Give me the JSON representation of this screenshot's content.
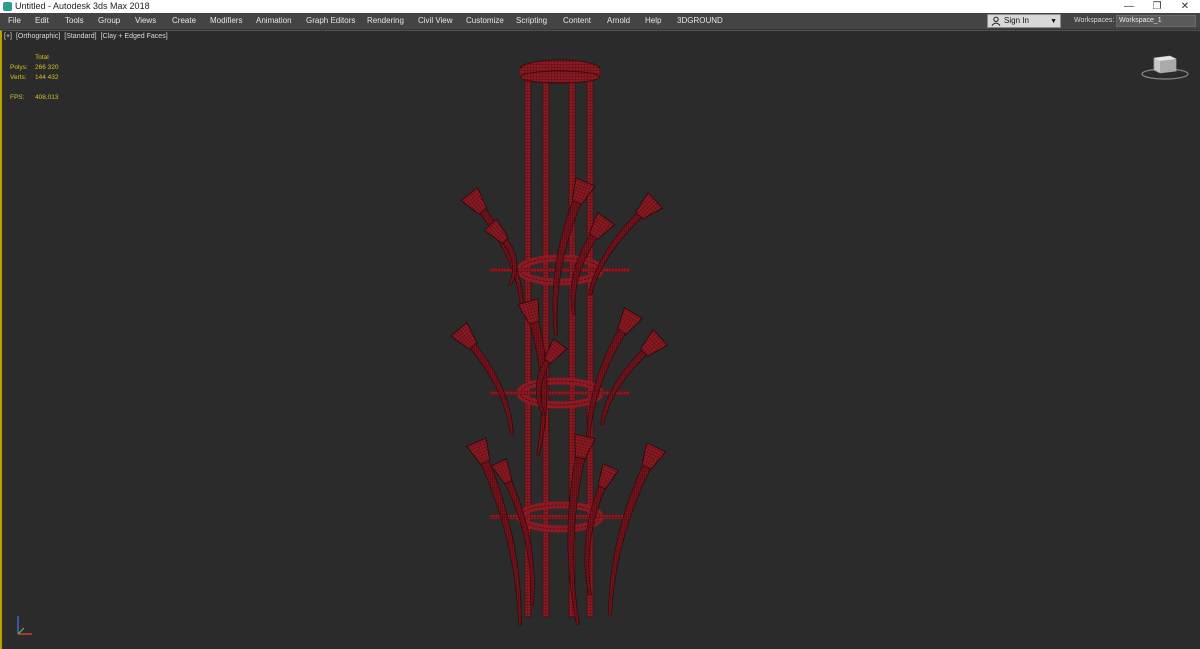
{
  "window": {
    "title": "Untitled - Autodesk 3ds Max 2018",
    "controls": [
      "—",
      "❐",
      "✕"
    ]
  },
  "menu": {
    "items": [
      "File",
      "Edit",
      "Tools",
      "Group",
      "Views",
      "Create",
      "Modifiers",
      "Animation",
      "Graph Editors",
      "Rendering",
      "Civil View",
      "Customize",
      "Scripting",
      "Content",
      "Arnold",
      "Help",
      "3DGROUND"
    ]
  },
  "account": {
    "sign_in": "Sign In"
  },
  "workspaces": {
    "label": "Workspaces:",
    "value": "Workspace_1"
  },
  "viewport": {
    "labels": [
      "[+]",
      "[Orthographic]",
      "[Standard]",
      "[Clay + Edged Faces]"
    ],
    "stats": {
      "total_label": "Total",
      "polys_label": "Polys:",
      "polys_value": "266 320",
      "verts_label": "Verts:",
      "verts_value": "144 432",
      "fps_label": "FPS:",
      "fps_value": "408,013"
    }
  },
  "colors": {
    "model": "#8c1a22",
    "wire": "#2a0608",
    "accent": "#b7a200"
  }
}
